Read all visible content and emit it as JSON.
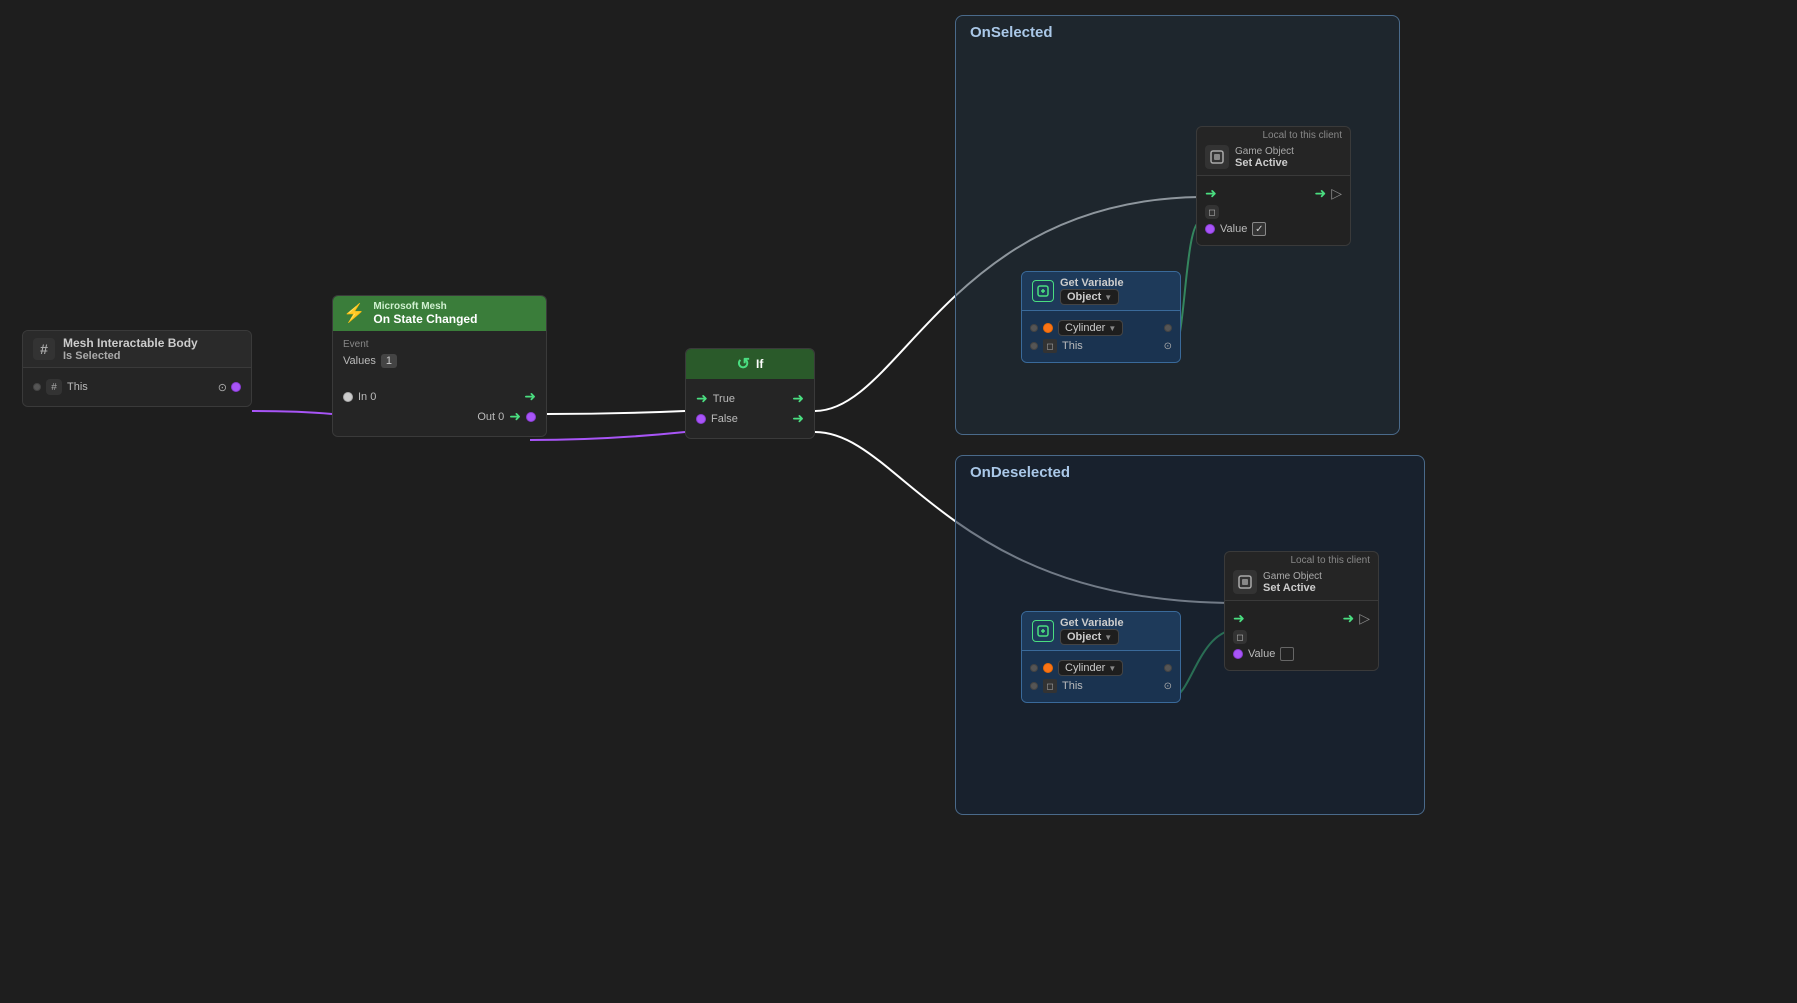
{
  "nodes": {
    "mesh_body": {
      "title": "Mesh Interactable Body",
      "subtitle": "Is Selected",
      "port_label": "This",
      "icon": "#"
    },
    "microsoft_mesh": {
      "provider": "Microsoft Mesh",
      "event": "On State Changed",
      "event_type": "Event",
      "values_label": "Values",
      "values_num": "1",
      "in_label": "In 0",
      "out_label": "Out 0"
    },
    "if_node": {
      "title": "If",
      "true_label": "True",
      "false_label": "False"
    },
    "onselected": {
      "title": "OnSelected",
      "local_label": "Local to this client",
      "gosetactive_label1": "Game Object",
      "gosetactive_label2": "Set Active",
      "getvar_title": "Get Variable",
      "getvar_sub": "Object",
      "cylinder_label": "Cylinder",
      "this_label": "This",
      "value_label": "Value"
    },
    "ondeselected": {
      "title": "OnDeselected",
      "local_label": "Local to this client",
      "gosetactive_label1": "Game Object",
      "gosetactive_label2": "Set Active",
      "getvar_title": "Get Variable",
      "getvar_sub": "Object",
      "cylinder_label": "Cylinder",
      "this_label": "This",
      "value_label": "Value"
    }
  }
}
